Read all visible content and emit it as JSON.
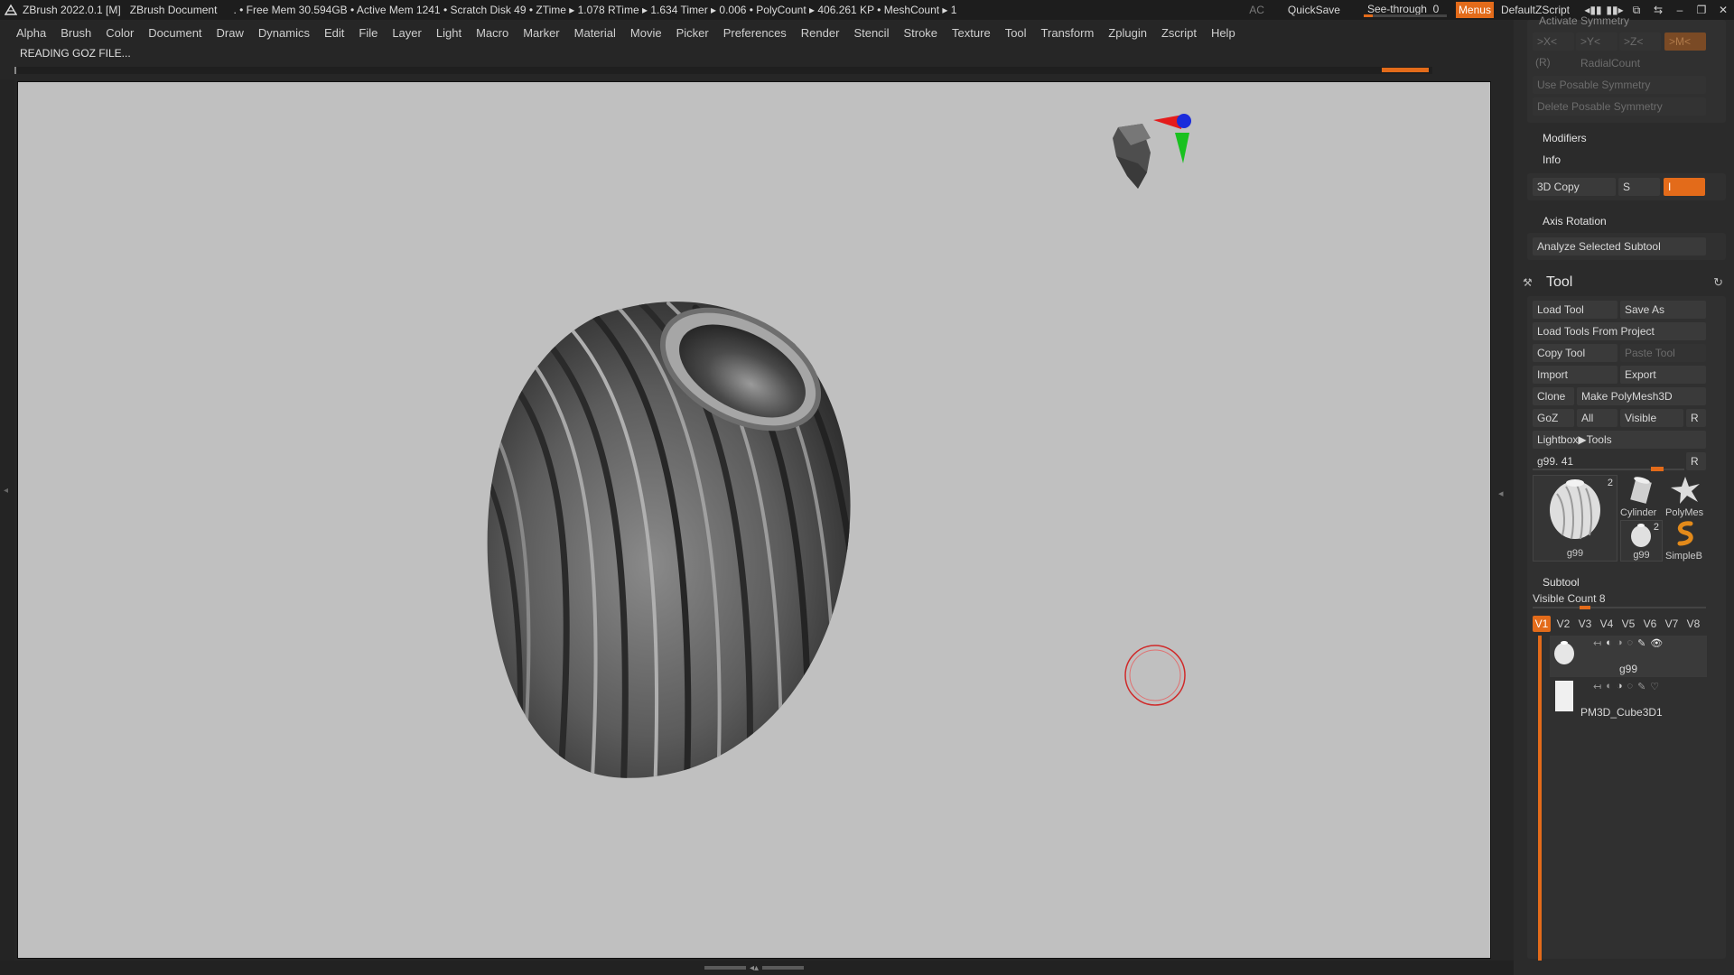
{
  "titlebar": {
    "app": "ZBrush 2022.0.1 [M]",
    "document": "ZBrush Document",
    "stats": ". • Free Mem 30.594GB • Active Mem 1241 • Scratch Disk 49 •  ZTime ▸ 1.078 RTime ▸ 1.634 Timer ▸ 0.006 • PolyCount ▸ 406.261 KP  • MeshCount ▸ 1",
    "ac": "AC",
    "quicksave": "QuickSave",
    "see_through_label": "See-through",
    "see_through_value": "0",
    "menus": "Menus",
    "zscript": "DefaultZScript"
  },
  "menu": [
    "Alpha",
    "Brush",
    "Color",
    "Document",
    "Draw",
    "Dynamics",
    "Edit",
    "File",
    "Layer",
    "Light",
    "Macro",
    "Marker",
    "Material",
    "Movie",
    "Picker",
    "Preferences",
    "Render",
    "Stencil",
    "Stroke",
    "Texture",
    "Tool",
    "Transform",
    "Zplugin",
    "Zscript",
    "Help"
  ],
  "status": "READING GOZ FILE...",
  "panel": {
    "activate_symmetry": "Activate Symmetry",
    "sym_x": ">X<",
    "sym_y": ">Y<",
    "sym_z": ">Z<",
    "sym_m": ">M<",
    "sym_r": "(R)",
    "radial_count": "RadialCount",
    "use_posable": "Use Posable Symmetry",
    "delete_posable": "Delete Posable Symmetry",
    "modifiers": "Modifiers",
    "info": "Info",
    "copy3d": "3D Copy",
    "s": "S",
    "i": "I",
    "axis_rotation": "Axis Rotation",
    "analyze": "Analyze Selected Subtool",
    "tool_title": "Tool",
    "load_tool": "Load Tool",
    "save_as": "Save As",
    "load_from_project": "Load Tools From Project",
    "copy_tool": "Copy Tool",
    "paste_tool": "Paste Tool",
    "import": "Import",
    "export": "Export",
    "clone": "Clone",
    "make_polymesh": "Make PolyMesh3D",
    "goz": "GoZ",
    "all": "All",
    "visible": "Visible",
    "r": "R",
    "lightbox_tools": "Lightbox▶Tools",
    "tool_slider": "g99. 41",
    "thumbs": {
      "main_name": "g99",
      "main_count": "2",
      "cylinder": "Cylinder",
      "polymesh": "PolyMes",
      "small_name": "g99",
      "small_count": "2",
      "simpleb": "SimpleB"
    },
    "subtool": "Subtool",
    "visible_count_label": "Visible Count",
    "visible_count_value": "8",
    "vtabs": [
      "V1",
      "V2",
      "V3",
      "V4",
      "V5",
      "V6",
      "V7",
      "V8"
    ],
    "subtools": [
      {
        "name": "g99"
      },
      {
        "name": "PM3D_Cube3D1"
      }
    ]
  }
}
